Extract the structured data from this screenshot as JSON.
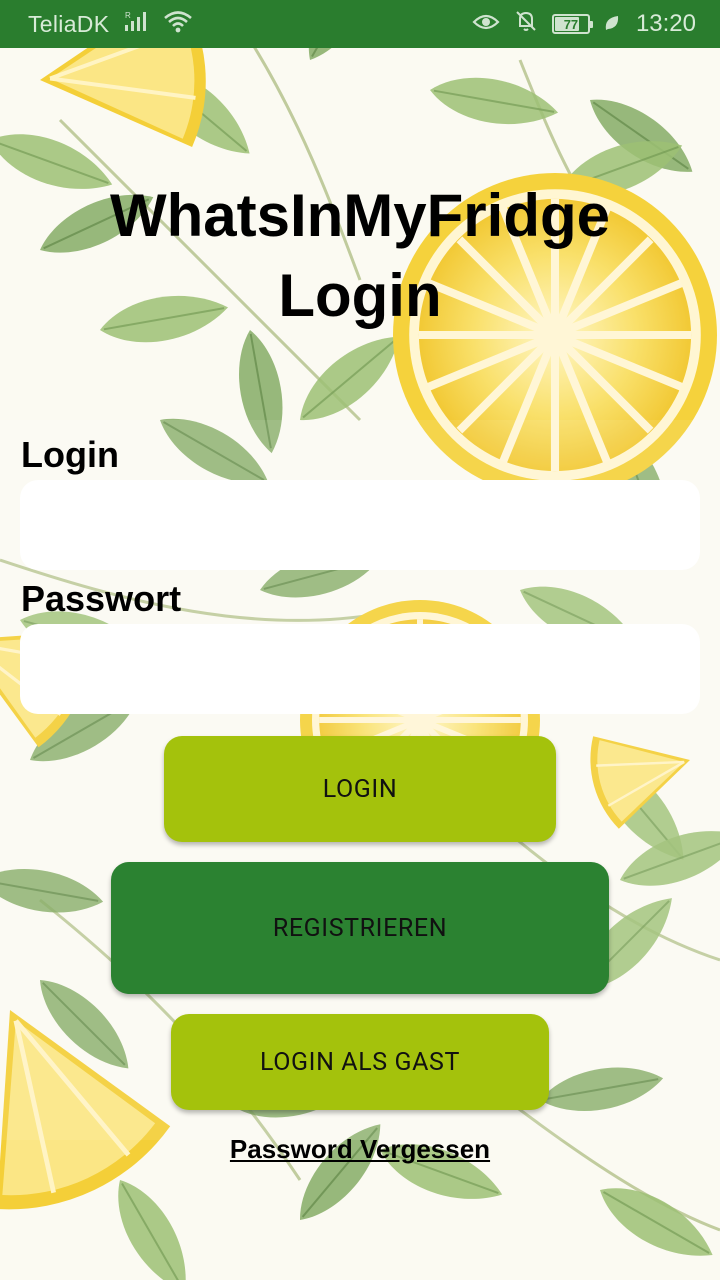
{
  "status_bar": {
    "carrier": "TeliaDK",
    "battery_level": "77",
    "battery_fraction": 0.77,
    "time": "13:20",
    "icons": [
      "signal-icon",
      "wifi-icon",
      "eye-comfort-icon",
      "mute-bell-icon",
      "battery-icon",
      "eco-leaf-icon"
    ]
  },
  "title": {
    "line1": "WhatsInMyFridge",
    "line2": "Login"
  },
  "form": {
    "login_label": "Login",
    "login_value": "",
    "password_label": "Passwort",
    "password_value": ""
  },
  "buttons": {
    "login": "LOGIN",
    "register": "REGISTRIEREN",
    "guest": "LOGIN ALS GAST"
  },
  "forgot_password": "Password Vergessen",
  "colors": {
    "status_bar": "#2a7d2e",
    "button_primary": "#a4c20c",
    "button_register": "#2b8231",
    "leaf": "#8fb36a",
    "lemon": "#f7d84a"
  }
}
